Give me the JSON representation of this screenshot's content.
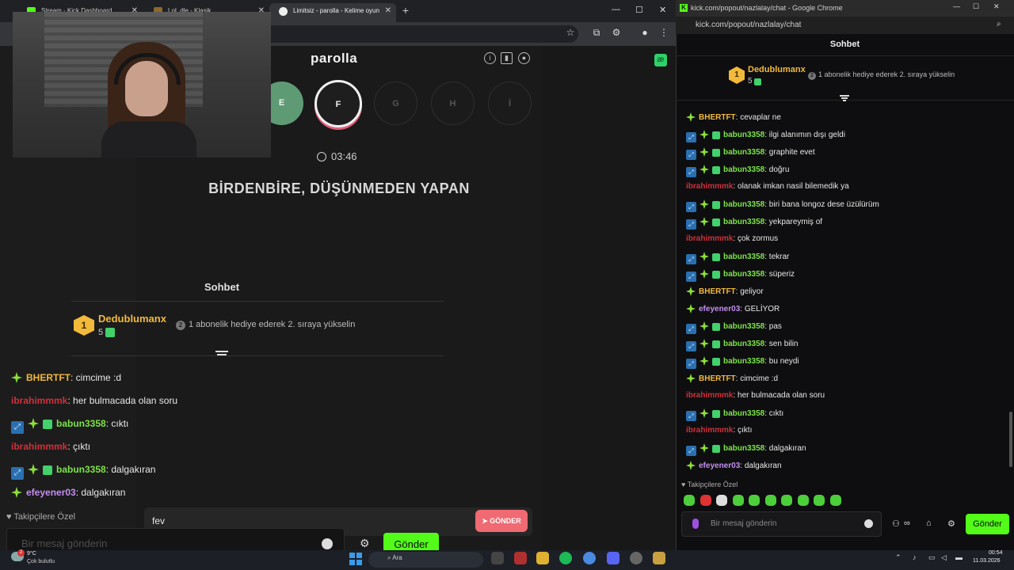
{
  "browser_left": {
    "tabs": [
      {
        "label": "Stream - Kick Dashboard"
      },
      {
        "label": "LoL dle - Klasik"
      },
      {
        "label": "Limitsiz - parolla - Kelime oyun"
      }
    ],
    "new_tab": "+"
  },
  "game": {
    "title": "parolla",
    "letters": [
      "E",
      "F",
      "G",
      "H",
      "İ"
    ],
    "timer": "03:46",
    "question": "BİRDENBİRE, DÜŞÜNMEDEN YAPAN",
    "answer_value": "fev",
    "send_label": "GÖNDER"
  },
  "overlay_chat": {
    "title": "Sohbet",
    "top_gifter": {
      "rank": "1",
      "name": "Dedublumanx",
      "count": "5"
    },
    "gift_note": "1 abonelik hediye ederek 2. sıraya yükselin",
    "gift_rank": "2",
    "messages": [
      {
        "user": "BHERTFT",
        "text": ": cimcime :d",
        "color": "#f2b93b"
      },
      {
        "user": "ibrahimmmk",
        "text": ": her bulmacada olan soru",
        "color": "#d0303a"
      },
      {
        "user": "babun3358",
        "text": ": cıktı",
        "color": "#7ce346"
      },
      {
        "user": "ibrahimmmk",
        "text": ": çıktı",
        "color": "#d0303a"
      },
      {
        "user": "babun3358",
        "text": ": dalgakıran",
        "color": "#7ce346"
      },
      {
        "user": "efeyener03",
        "text": ": dalgakıran",
        "color": "#c48ef0"
      }
    ],
    "follower_only": "Takipçilere Özel",
    "input_placeholder": "Bir mesaj gönderin",
    "send_label": "Gönder"
  },
  "browser_right": {
    "window_title": "kick.com/popout/nazlalay/chat - Google Chrome",
    "url": "kick.com/popout/nazlalay/chat",
    "chat_title": "Sohbet",
    "top_gifter": {
      "rank": "1",
      "name": "Dedublumanx",
      "count": "5"
    },
    "gift_note": "1 abonelik hediye ederek 2. sıraya yükselin",
    "gift_rank": "2",
    "messages": [
      {
        "user": "BHERTFT",
        "text": ": cevaplar ne",
        "color": "#f2b93b",
        "badges": "spark"
      },
      {
        "user": "babun3358",
        "text": ": ilgi alanımın dışı geldi",
        "color": "#7ce346",
        "badges": "full"
      },
      {
        "user": "babun3358",
        "text": ": graphite evet",
        "color": "#7ce346",
        "badges": "full"
      },
      {
        "user": "babun3358",
        "text": ": doğru",
        "color": "#7ce346",
        "badges": "full"
      },
      {
        "user": "ibrahimmmk",
        "text": ": olanak imkan nasil bilemedik ya",
        "color": "#d0303a",
        "badges": "none"
      },
      {
        "user": "babun3358",
        "text": ": biri bana longoz dese üzülürüm",
        "color": "#7ce346",
        "badges": "full"
      },
      {
        "user": "babun3358",
        "text": ": yekpareymiş of",
        "color": "#7ce346",
        "badges": "full"
      },
      {
        "user": "ibrahimmmk",
        "text": ": çok zormus",
        "color": "#d0303a",
        "badges": "none"
      },
      {
        "user": "babun3358",
        "text": ": tekrar",
        "color": "#7ce346",
        "badges": "full"
      },
      {
        "user": "babun3358",
        "text": ": süperiz",
        "color": "#7ce346",
        "badges": "full"
      },
      {
        "user": "BHERTFT",
        "text": ": geliyor",
        "color": "#f2b93b",
        "badges": "spark"
      },
      {
        "user": "efeyener03",
        "text": ": GELİYOR",
        "color": "#c48ef0",
        "badges": "spark"
      },
      {
        "user": "babun3358",
        "text": ": pas",
        "color": "#7ce346",
        "badges": "full"
      },
      {
        "user": "babun3358",
        "text": ": sen bilin",
        "color": "#7ce346",
        "badges": "full"
      },
      {
        "user": "babun3358",
        "text": ": bu neydi",
        "color": "#7ce346",
        "badges": "full"
      },
      {
        "user": "BHERTFT",
        "text": ": cimcime :d",
        "color": "#f2b93b",
        "badges": "spark"
      },
      {
        "user": "ibrahimmmk",
        "text": ": her bulmacada olan soru",
        "color": "#d0303a",
        "badges": "none"
      },
      {
        "user": "babun3358",
        "text": ": cıktı",
        "color": "#7ce346",
        "badges": "full"
      },
      {
        "user": "ibrahimmmk",
        "text": ": çıktı",
        "color": "#d0303a",
        "badges": "none"
      },
      {
        "user": "babun3358",
        "text": ": dalgakıran",
        "color": "#7ce346",
        "badges": "full"
      },
      {
        "user": "efeyener03",
        "text": ": dalgakıran",
        "color": "#c48ef0",
        "badges": "spark"
      }
    ],
    "follower_only": "Takipçilere Özel",
    "input_placeholder": "Bir mesaj gönderin",
    "send_label": "Gönder"
  },
  "taskbar": {
    "weather_temp": "9°C",
    "weather_cond": "Çok bulutlu",
    "weather_badge": "2",
    "search_placeholder": "Ara",
    "time": "00:54",
    "date": "11.03.2026"
  },
  "colors": {
    "kick_green": "#53fc18",
    "parolla_red": "#ef6a72",
    "done_letter": "#5e9b74"
  }
}
